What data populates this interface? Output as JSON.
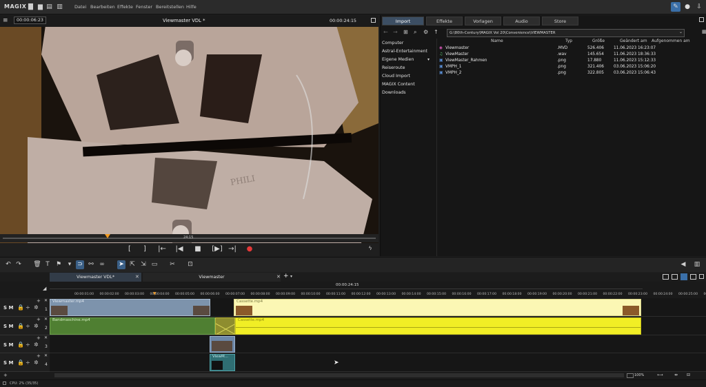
{
  "app": {
    "logo": "MAGIX"
  },
  "menu": [
    "Datei",
    "Bearbeiten",
    "Effekte",
    "Fenster",
    "Bereitstellen",
    "Hilfe"
  ],
  "icons": [
    "new-file-icon",
    "open-folder-icon",
    "save-icon",
    "pin-icon",
    "help-icon",
    "download-icon"
  ],
  "preview": {
    "time_left": "00:00:06:23",
    "title": "Viewmaster VDL *",
    "time_right": "00:00:24:15",
    "scrub_time": "24:15",
    "controls": [
      "[",
      "]",
      "|←",
      "|◀",
      "■",
      "[▶]",
      "→|",
      "●"
    ]
  },
  "pool": {
    "tabs": [
      "Import",
      "Effekte",
      "Vorlagen",
      "Audio",
      "Store"
    ],
    "path": "G:\\80th-Century\\MAGIX Vol 20\\Convenience\\VIEWMASTER",
    "nav": [
      "Computer",
      "Astral-Entertainment",
      "Eigene Medien",
      "Reiseroute",
      "Cloud Import",
      "MAGIX Content",
      "Downloads"
    ],
    "columns": {
      "name": "Name",
      "type": "Typ",
      "size": "Größe",
      "changed": "Geändert am",
      "recorded": "Aufgenommen am"
    },
    "files": [
      {
        "name": "Viewmaster",
        "type": ".MVD",
        "size": "526.406",
        "date": "11.06.2023 16:23:07"
      },
      {
        "name": "ViewMaster",
        "type": ".wav",
        "size": "145.654",
        "date": "11.06.2023 18:36:33"
      },
      {
        "name": "ViewMaster_Rahmen",
        "type": ".png",
        "size": "17.880",
        "date": "11.06.2023 15:12:33"
      },
      {
        "name": "VMPH_1",
        "type": ".png",
        "size": "321.406",
        "date": "03.06.2023 15:06:20"
      },
      {
        "name": "VMPH_2",
        "type": ".png",
        "size": "322.805",
        "date": "03.06.2023 15:06:43"
      }
    ]
  },
  "timeline": {
    "tabs": [
      "Viewmaster VDL*",
      "Viewmaster"
    ],
    "ruler_time": "00:00:24:15",
    "ticks": [
      "00:00:01:00",
      "00:00:02:00",
      "00:00:03:00",
      "00:00:04:00",
      "00:00:05:00",
      "00:00:06:00",
      "00:00:07:00",
      "00:00:08:00",
      "00:00:09:00",
      "00:00:10:00",
      "00:00:11:00",
      "00:00:12:00",
      "00:00:13:00",
      "00:00:14:00",
      "00:00:15:00",
      "00:00:16:00",
      "00:00:17:00",
      "00:00:18:00",
      "00:00:19:00",
      "00:00:20:00",
      "00:00:21:00",
      "00:00:22:00",
      "00:00:23:00",
      "00:00:24:00",
      "00:00:25:00",
      "00:00:26:00"
    ],
    "tracks": [
      "1",
      "2",
      "3",
      "4"
    ],
    "smb": "S M",
    "clips": {
      "t1a": "Viewmaster.mp4",
      "t1b": "Cassette.mp4",
      "t2a": "Bandmaschine.mp4",
      "t2b": "Cassette.mp4",
      "t4": "ViewM..."
    },
    "zoom": "100%"
  },
  "status": {
    "cpu": "CPU: 2% (35/35)"
  },
  "colors": {
    "accent": "#3a5f86",
    "clip_blue": "#7f95ad",
    "clip_green": "#4f7f32",
    "clip_yellow": "#f1ee25",
    "clip_light": "#fbf7b4",
    "record": "#e43838"
  }
}
